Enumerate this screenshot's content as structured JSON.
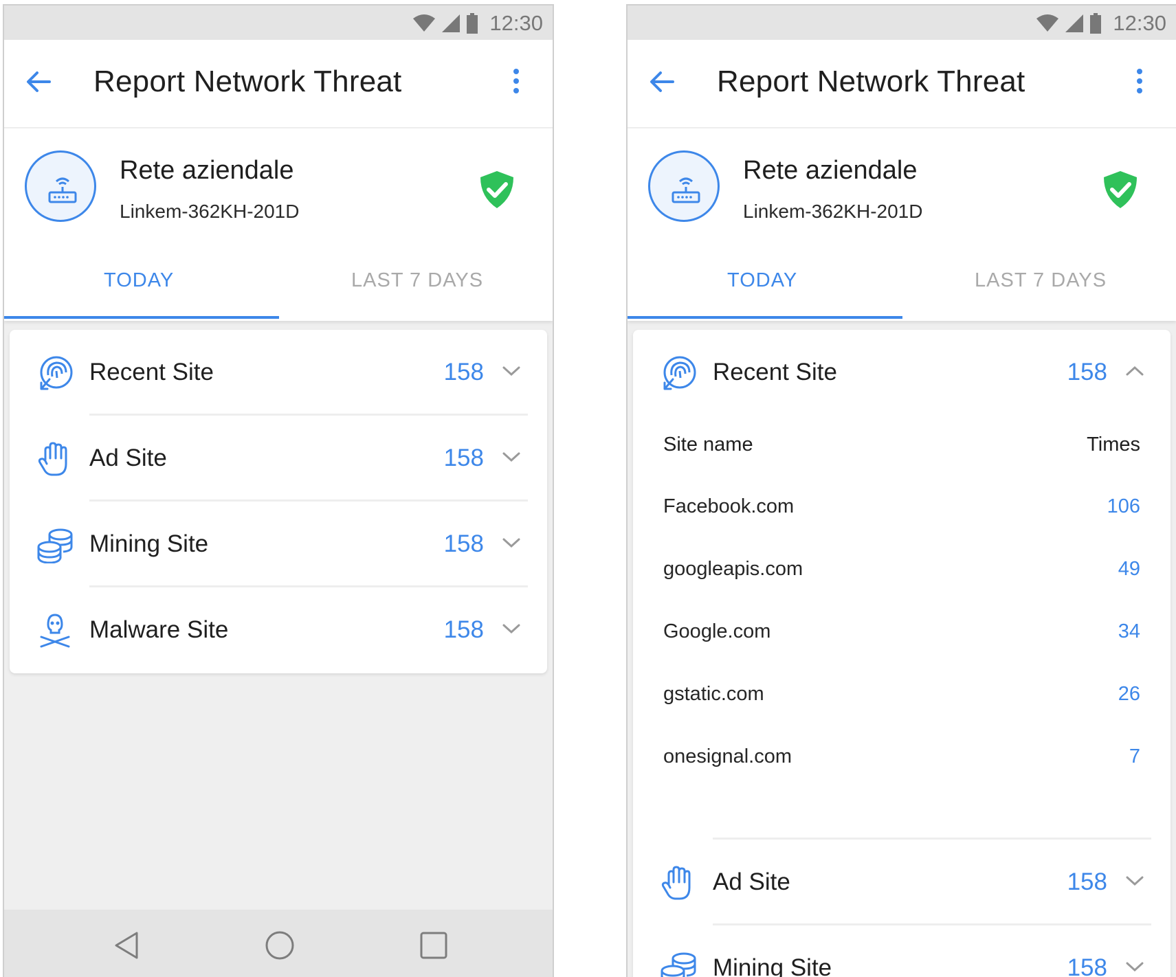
{
  "status_bar": {
    "time": "12:30",
    "icons": [
      "wifi-icon",
      "signal-icon",
      "battery-icon"
    ]
  },
  "app_bar": {
    "title": "Report Network Threat",
    "back_icon": "arrow-left-icon",
    "more_icon": "more-vert-icon"
  },
  "network": {
    "name": "Rete aziendale",
    "ssid": "Linkem-362KH-201D",
    "icon": "router-icon",
    "status_icon": "shield-check-icon",
    "status_color": "#2fc15a"
  },
  "tabs": [
    {
      "label": "TODAY",
      "selected": true
    },
    {
      "label": "LAST 7 DAYS",
      "selected": false
    }
  ],
  "categories": [
    {
      "label": "Recent Site",
      "count": "158",
      "icon": "fingerprint-icon"
    },
    {
      "label": "Ad Site",
      "count": "158",
      "icon": "hand-icon"
    },
    {
      "label": "Mining Site",
      "count": "158",
      "icon": "coins-icon"
    },
    {
      "label": "Malware Site",
      "count": "158",
      "icon": "skull-crossbones-icon"
    }
  ],
  "recent_table": {
    "header_site": "Site name",
    "header_times": "Times",
    "rows": [
      {
        "site": "Facebook.com",
        "times": "106"
      },
      {
        "site": "googleapis.com",
        "times": "49"
      },
      {
        "site": "Google.com",
        "times": "34"
      },
      {
        "site": "gstatic.com",
        "times": "26"
      },
      {
        "site": "onesignal.com",
        "times": "7"
      }
    ]
  },
  "nav_bar": {
    "icons": [
      "back-triangle-icon",
      "home-circle-icon",
      "recents-square-icon"
    ]
  },
  "colors": {
    "accent": "#3d87e9",
    "text": "#1f1f1f",
    "tab_inactive": "#a9a9a9",
    "background": "#efefef"
  }
}
